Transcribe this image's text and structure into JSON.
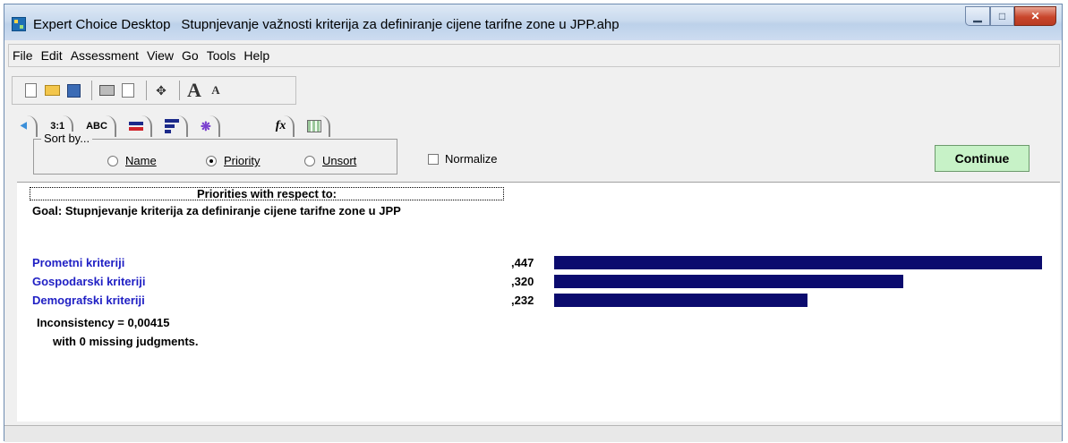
{
  "window": {
    "app_title": "Expert Choice Desktop",
    "document_title": "Stupnjevanje važnosti kriterija za definiranje cijene tarifne zone u JPP.ahp",
    "minimize_glyph": "▁",
    "maximize_glyph": "□",
    "close_glyph": "✕"
  },
  "menu": [
    {
      "label": "File"
    },
    {
      "label": "Edit"
    },
    {
      "label": "Assessment"
    },
    {
      "label": "View"
    },
    {
      "label": "Go"
    },
    {
      "label": "Tools"
    },
    {
      "label": "Help"
    }
  ],
  "toolbar": {
    "icons": [
      "new-document-icon",
      "open-folder-icon",
      "save-disk-icon",
      "print-icon",
      "print-preview-icon",
      "pointer-icon",
      "font-larger-icon",
      "font-smaller-icon"
    ],
    "pointer_glyph": "✥",
    "font_larger_label": "A",
    "font_smaller_label": "A"
  },
  "tabs": {
    "tree_glyph": "⯇",
    "pairwise_label": "3:1",
    "verbal_label": "ABC",
    "graph_glyph": "❋",
    "formula_label": "fx",
    "icons": [
      "model-tree-icon",
      "pairwise-numerical-icon",
      "pairwise-verbal-icon",
      "priorities-bar-icon",
      "priorities-sorted-icon",
      "hierarchy-icon",
      "formula-icon",
      "grid-icon"
    ]
  },
  "sort": {
    "legend": "Sort by...",
    "options": [
      "Name",
      "Priority",
      "Unsort"
    ],
    "selected": "Priority"
  },
  "normalize": {
    "label": "Normalize",
    "checked": false
  },
  "continue_label": "Continue",
  "content": {
    "header": "Priorities with respect to:",
    "goal": "Goal: Stupnjevanje kriterija za definiranje cijene tarifne zone u JPP",
    "inconsistency": "Inconsistency = 0,00415",
    "missing": "with 0  missing judgments."
  },
  "colors": {
    "bar": "#0b0b6e",
    "criterion_text": "#1f1fc4",
    "continue_bg": "#c7f2c7"
  },
  "chart_data": {
    "type": "bar",
    "categories": [
      "Prometni kriteriji",
      "Gospodarski kriteriji",
      "Demografski kriteriji"
    ],
    "values": [
      0.447,
      0.32,
      0.232
    ],
    "value_labels": [
      ",447",
      ",320",
      ",232"
    ],
    "title": "",
    "xlabel": "",
    "ylabel": ""
  }
}
